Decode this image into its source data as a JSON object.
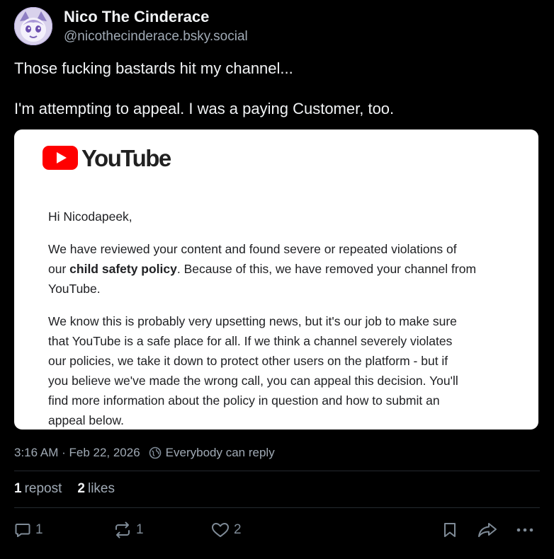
{
  "author": {
    "display_name": "Nico The Cinderace",
    "handle": "@nicothecinderace.bsky.social"
  },
  "post": {
    "lines": [
      "Those fucking bastards hit my channel...",
      "I'm attempting to appeal. I was a paying Customer, too."
    ]
  },
  "embed": {
    "brand": "YouTube",
    "greeting": "Hi Nicodapeek,",
    "p1_line1": "We have reviewed your content and found severe or repeated violations of",
    "p1_line2_pre": "our ",
    "p1_line2_bold": "child safety policy",
    "p1_line2_post": ". Because of this, we have removed your channel from",
    "p1_line3": "YouTube.",
    "p2_lines": [
      "We know this is probably very upsetting news, but it's our job to make sure",
      "that YouTube is a safe place for all. If we think a channel severely violates",
      "our policies, we take it down to protect other users on the platform - but if",
      "you believe we've made the wrong call, you can appeal this decision. You'll",
      "find more information about the policy in question and how to submit an",
      "appeal below."
    ]
  },
  "meta": {
    "timestamp": "3:16 AM · Feb 22, 2026",
    "reply_setting": "Everybody can reply"
  },
  "stats": {
    "reposts_count": "1",
    "reposts_label": "repost",
    "likes_count": "2",
    "likes_label": "likes"
  },
  "actions": {
    "reply_count": "1",
    "repost_count": "1",
    "like_count": "2"
  },
  "colors": {
    "background": "#000000",
    "youtube_red": "#ff0000",
    "muted": "#a0aab5"
  },
  "icons": [
    "avatar-cinderace",
    "globe-icon",
    "reply-icon",
    "repost-icon",
    "like-icon",
    "bookmark-icon",
    "share-icon",
    "more-icon",
    "youtube-play-icon"
  ]
}
